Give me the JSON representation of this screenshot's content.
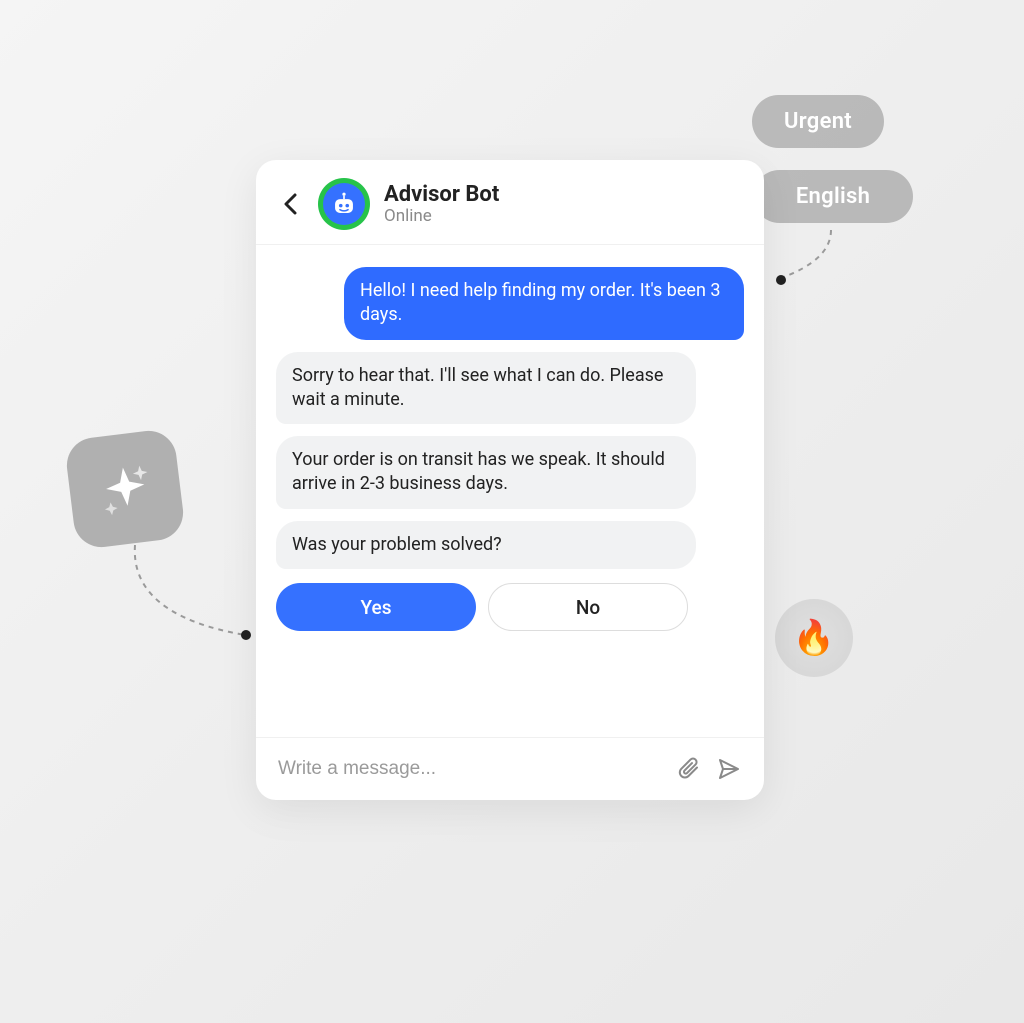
{
  "header": {
    "bot_name": "Advisor Bot",
    "status": "Online"
  },
  "messages": {
    "user1": "Hello! I need help finding my order. It's been 3 days.",
    "bot1": "Sorry to hear that. I'll see what I can do. Please wait a minute.",
    "bot2": "Your order is on transit has we speak. It should arrive in 2-3 business days.",
    "bot3": "Was your problem solved?"
  },
  "options": {
    "yes": "Yes",
    "no": "No"
  },
  "input": {
    "placeholder": "Write a message..."
  },
  "badges": {
    "urgent": "Urgent",
    "english": "English"
  },
  "fire_emoji": "🔥"
}
